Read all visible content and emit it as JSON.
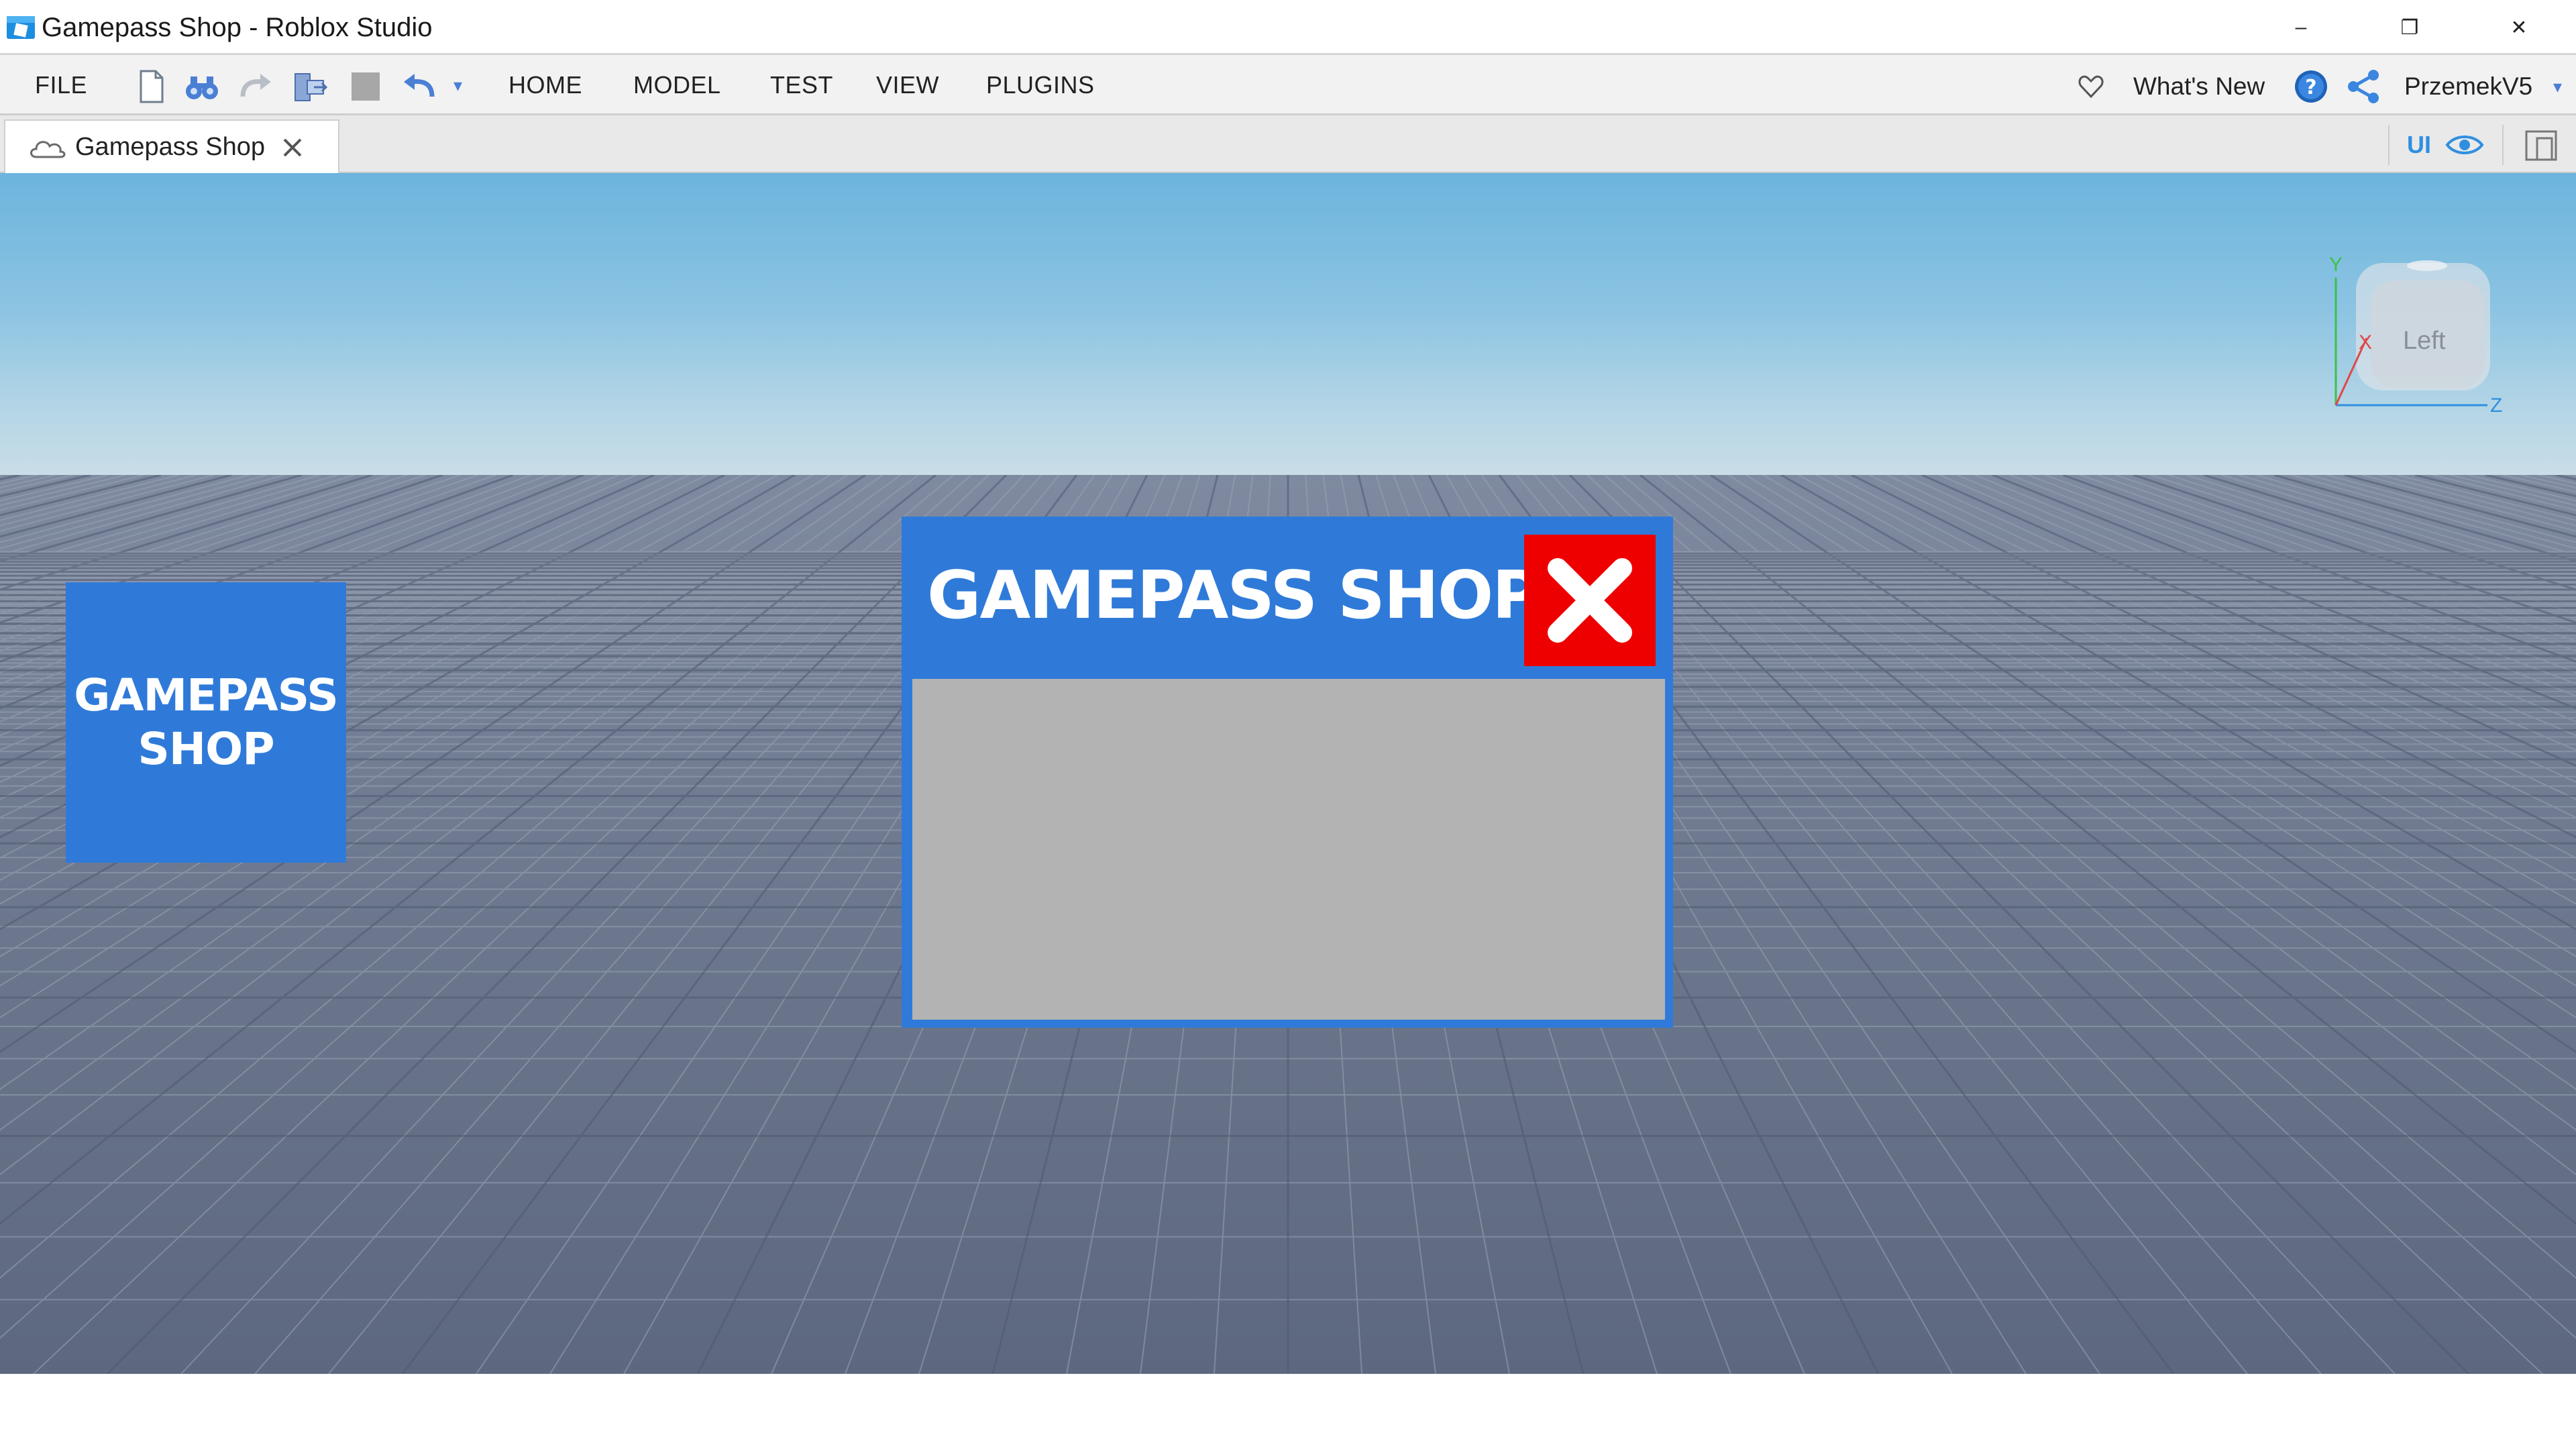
{
  "window": {
    "title": "Gamepass Shop - Roblox Studio",
    "controls": {
      "minimize": "–",
      "restore": "❐",
      "close": "✕"
    }
  },
  "menubar": {
    "file_label": "FILE",
    "tabs": [
      {
        "label": "HOME"
      },
      {
        "label": "MODEL"
      },
      {
        "label": "TEST"
      },
      {
        "label": "VIEW"
      },
      {
        "label": "PLUGINS"
      }
    ],
    "quick_access_icons": [
      "new-file-icon",
      "binoculars-icon",
      "redo-icon",
      "import-icon",
      "stop-icon",
      "undo-icon",
      "customize-dropdown-icon"
    ],
    "whats_new_label": "What's New",
    "username": "PrzemekV5",
    "user_dropdown_arrow": "▾",
    "quick_access_arrow": "▾"
  },
  "tabstrip": {
    "document_tab_label": "Gamepass Shop",
    "ui_toggle_label": "UI"
  },
  "viewport": {
    "navcube_face": "Left",
    "axes": {
      "y": "Y",
      "x": "X",
      "z": "Z"
    }
  },
  "game_ui": {
    "shop_button": {
      "line1": "GAMEPASS",
      "line2": "SHOP"
    },
    "shop_frame": {
      "title": "GAMEPASS SHOP"
    }
  },
  "colors": {
    "shop_blue": "#2f7ad9",
    "close_red": "#ee0000",
    "content_gray": "#b3b3b3",
    "accent_blue": "#2f8fe0"
  }
}
